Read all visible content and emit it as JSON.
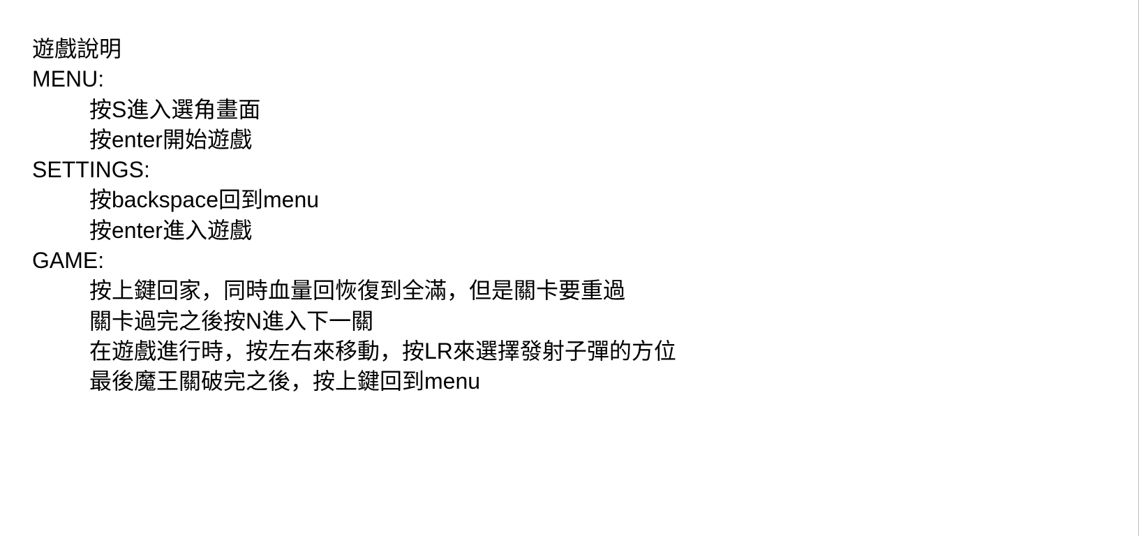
{
  "title": "遊戲說明",
  "sections": [
    {
      "heading": "MENU:",
      "lines": [
        "按S進入選角畫面",
        "按enter開始遊戲"
      ]
    },
    {
      "heading": "SETTINGS:",
      "lines": [
        "按backspace回到menu",
        "按enter進入遊戲"
      ]
    },
    {
      "heading": "GAME:",
      "lines": [
        "按上鍵回家，同時血量回恢復到全滿，但是關卡要重過",
        "關卡過完之後按N進入下一關",
        "在遊戲進行時，按左右來移動，按LR來選擇發射子彈的方位",
        "最後魔王關破完之後，按上鍵回到menu"
      ]
    }
  ]
}
